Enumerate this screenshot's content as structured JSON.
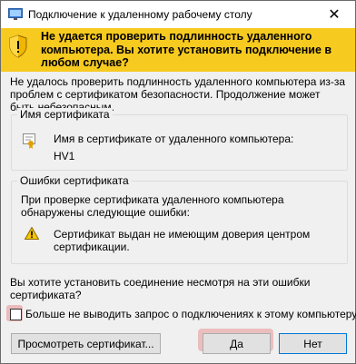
{
  "window": {
    "title": "Подключение к удаленному рабочему столу",
    "close_glyph": "✕"
  },
  "banner": {
    "text": "Не удается проверить подлинность удаленного компьютера. Вы хотите установить подключение в любом случае?"
  },
  "body": {
    "text": "Не удалось проверить подлинность удаленного компьютера из-за проблем с сертификатом безопасности. Продолжение может быть небезопасным."
  },
  "cert_group": {
    "legend": "Имя сертификата",
    "label": "Имя в сертификате от удаленного компьютера:",
    "value": "HV1"
  },
  "errors_group": {
    "legend": "Ошибки сертификата",
    "intro": "При проверке сертификата удаленного компьютера обнаружены следующие ошибки:",
    "error": "Сертификат выдан не имеющим доверия центром сертификации."
  },
  "question": "Вы хотите установить соединение несмотря на эти ошибки сертификата?",
  "checkbox": {
    "label": "Больше не выводить запрос о подключениях к этому компьютеру",
    "checked": false
  },
  "buttons": {
    "view": "Просмотреть сертификат...",
    "yes": "Да",
    "no": "Нет"
  },
  "colors": {
    "banner": "#f7ca1f",
    "highlight": "#e89696",
    "focus_border": "#0078d7"
  }
}
